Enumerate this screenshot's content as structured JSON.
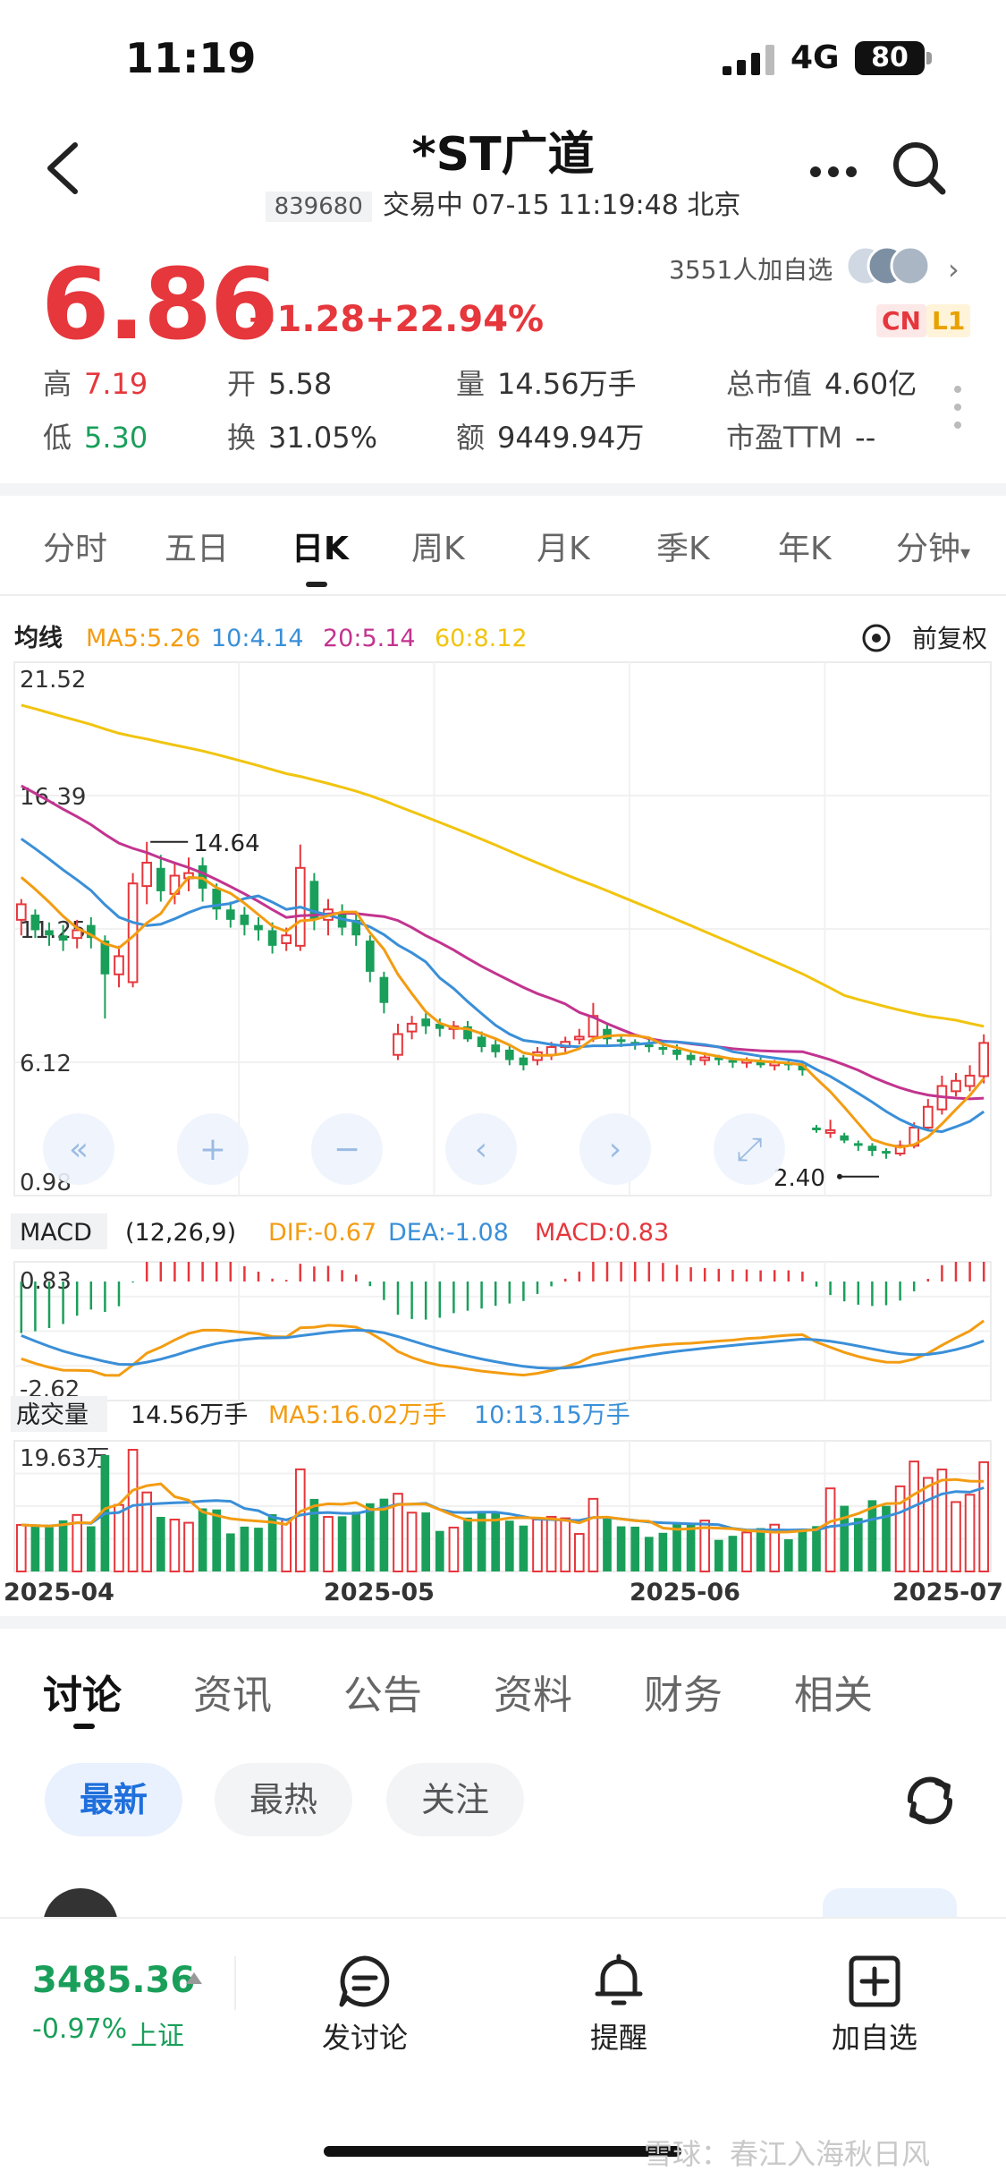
{
  "status": {
    "time": "11:19",
    "network": "4G",
    "battery": "80"
  },
  "header": {
    "title": "*ST广道",
    "code": "839680",
    "trade_info": "交易中 07-15 11:19:48 北京"
  },
  "quote": {
    "price": "6.86",
    "change": "+1.28",
    "change_pct": "+22.94%",
    "watchers": "3551人加自选",
    "badge_cn": "CN",
    "badge_l1": "L1",
    "stats": [
      {
        "label": "高",
        "value": "7.19"
      },
      {
        "label": "开",
        "value": "5.58"
      },
      {
        "label": "量",
        "value": "14.56万手"
      },
      {
        "label": "总市值",
        "value": "4.60亿"
      },
      {
        "label": "低",
        "value": "5.30"
      },
      {
        "label": "换",
        "value": "31.05%"
      },
      {
        "label": "额",
        "value": "9449.94万"
      },
      {
        "label": "市盈TTM",
        "value": "--"
      }
    ]
  },
  "ktabs": [
    "分时",
    "五日",
    "日K",
    "周K",
    "月K",
    "季K",
    "年K",
    "分钟"
  ],
  "chart_data": {
    "type": "candlestick",
    "ma_header": {
      "label": "均线",
      "ma5": "MA5:5.26",
      "ma10": "10:4.14",
      "ma20": "20:5.14",
      "ma60": "60:8.12"
    },
    "adjust_label": "前复权",
    "price_ticks": [
      "21.52",
      "16.39",
      "11.25",
      "6.12",
      "0.98"
    ],
    "ylim": [
      0.98,
      21.52
    ],
    "high_annotation": "14.64",
    "low_annotation": "2.40",
    "candles": [
      [
        11.6,
        12.2,
        11.0,
        12.4
      ],
      [
        11.8,
        11.2,
        10.9,
        12.0
      ],
      [
        11.2,
        11.0,
        10.6,
        11.5
      ],
      [
        11.0,
        10.8,
        10.4,
        11.4
      ],
      [
        10.9,
        11.2,
        10.5,
        11.6
      ],
      [
        11.4,
        10.9,
        10.5,
        11.7
      ],
      [
        10.8,
        9.5,
        7.8,
        11.0
      ],
      [
        9.5,
        10.2,
        9.0,
        10.6
      ],
      [
        9.2,
        13.0,
        9.0,
        13.4
      ],
      [
        12.9,
        13.8,
        12.2,
        14.6
      ],
      [
        13.6,
        12.7,
        12.3,
        14.1
      ],
      [
        12.6,
        13.3,
        12.2,
        13.8
      ],
      [
        13.2,
        13.4,
        12.7,
        14.0
      ],
      [
        13.7,
        12.8,
        12.3,
        14.0
      ],
      [
        12.8,
        12.0,
        11.6,
        13.0
      ],
      [
        12.0,
        11.6,
        11.3,
        12.3
      ],
      [
        11.8,
        11.4,
        11.0,
        12.1
      ],
      [
        11.4,
        11.2,
        10.8,
        11.7
      ],
      [
        11.2,
        10.6,
        10.3,
        11.5
      ],
      [
        10.7,
        11.0,
        10.4,
        11.3
      ],
      [
        10.6,
        13.6,
        10.4,
        14.5
      ],
      [
        13.1,
        11.6,
        11.2,
        13.4
      ],
      [
        11.6,
        12.0,
        11.0,
        12.4
      ],
      [
        11.9,
        11.3,
        11.0,
        12.2
      ],
      [
        11.6,
        11.0,
        10.6,
        11.8
      ],
      [
        10.8,
        9.6,
        9.2,
        11.0
      ],
      [
        9.4,
        8.4,
        8.0,
        9.6
      ],
      [
        6.4,
        7.2,
        6.2,
        7.6
      ],
      [
        7.3,
        7.6,
        7.0,
        7.9
      ],
      [
        7.8,
        7.5,
        7.2,
        8.0
      ],
      [
        7.6,
        7.4,
        7.1,
        7.8
      ],
      [
        7.4,
        7.5,
        7.0,
        7.7
      ],
      [
        7.5,
        7.0,
        6.9,
        7.7
      ],
      [
        7.1,
        6.7,
        6.5,
        7.3
      ],
      [
        6.8,
        6.5,
        6.3,
        7.0
      ],
      [
        6.6,
        6.2,
        6.0,
        6.8
      ],
      [
        6.3,
        6.0,
        5.8,
        6.4
      ],
      [
        6.2,
        6.5,
        6.0,
        6.7
      ],
      [
        6.4,
        6.7,
        6.2,
        6.9
      ],
      [
        6.7,
        6.9,
        6.5,
        7.1
      ],
      [
        7.0,
        7.1,
        6.8,
        7.4
      ],
      [
        7.1,
        7.9,
        6.9,
        8.4
      ],
      [
        7.4,
        7.0,
        6.8,
        7.6
      ],
      [
        7.0,
        6.9,
        6.7,
        7.2
      ],
      [
        6.9,
        6.8,
        6.6,
        7.0
      ],
      [
        6.8,
        6.7,
        6.5,
        7.0
      ],
      [
        6.7,
        6.6,
        6.4,
        6.9
      ],
      [
        6.6,
        6.4,
        6.2,
        6.8
      ],
      [
        6.4,
        6.2,
        6.0,
        6.5
      ],
      [
        6.2,
        6.3,
        6.0,
        6.5
      ],
      [
        6.3,
        6.2,
        6.0,
        6.4
      ],
      [
        6.2,
        6.1,
        5.9,
        6.3
      ],
      [
        6.1,
        6.2,
        5.9,
        6.3
      ],
      [
        6.2,
        6.0,
        5.9,
        6.3
      ],
      [
        6.0,
        6.1,
        5.8,
        6.2
      ],
      [
        6.1,
        6.0,
        5.8,
        6.2
      ],
      [
        6.0,
        5.8,
        5.6,
        6.1
      ],
      [
        3.6,
        3.5,
        3.4,
        3.7
      ],
      [
        3.4,
        3.5,
        3.2,
        3.9
      ],
      [
        3.3,
        3.1,
        3.0,
        3.4
      ],
      [
        3.0,
        2.9,
        2.7,
        3.1
      ],
      [
        2.9,
        2.7,
        2.5,
        3.0
      ],
      [
        2.7,
        2.6,
        2.4,
        2.8
      ],
      [
        2.6,
        2.9,
        2.5,
        3.1
      ],
      [
        2.9,
        3.6,
        2.8,
        3.8
      ],
      [
        3.6,
        4.4,
        3.5,
        4.7
      ],
      [
        4.3,
        5.2,
        4.1,
        5.6
      ],
      [
        5.0,
        5.4,
        4.8,
        5.7
      ],
      [
        5.2,
        5.6,
        5.0,
        6.0
      ],
      [
        5.58,
        6.86,
        5.3,
        7.19
      ]
    ],
    "macd_header": {
      "label": "MACD",
      "params": "(12,26,9)",
      "dif": "DIF:-0.67",
      "dea": "DEA:-1.08",
      "macd": "MACD:0.83"
    },
    "macd_ticks": [
      "0.83",
      "-2.62"
    ],
    "macd_range": [
      -2.62,
      0.83
    ],
    "vol_header": {
      "label": "成交量",
      "value": "14.56万手",
      "ma5": "MA5:16.02万手",
      "ma10": "10:13.15万手"
    },
    "vol_max_label": "19.63万",
    "vol_max": 19.63,
    "dates": [
      "2025-04",
      "2025-05",
      "2025-06",
      "2025-07"
    ],
    "nav_buttons": [
      "«",
      "+",
      "−",
      "‹",
      "›",
      "⤢"
    ]
  },
  "btabs": [
    "讨论",
    "资讯",
    "公告",
    "资料",
    "财务",
    "相关"
  ],
  "filters": [
    "最新",
    "最热",
    "关注"
  ],
  "bottom": {
    "index_value": "3485.36",
    "index_change": "-0.97%",
    "index_name": "上证",
    "nav": [
      "发讨论",
      "提醒",
      "加自选"
    ]
  },
  "colors": {
    "up": "#e5373c",
    "down": "#1a9f5a",
    "ma5": "#f39c12",
    "ma10": "#3a8fd8",
    "ma20": "#c2348f",
    "ma60": "#f1c40f"
  },
  "watermark": "雪球：春江入海秋日风"
}
